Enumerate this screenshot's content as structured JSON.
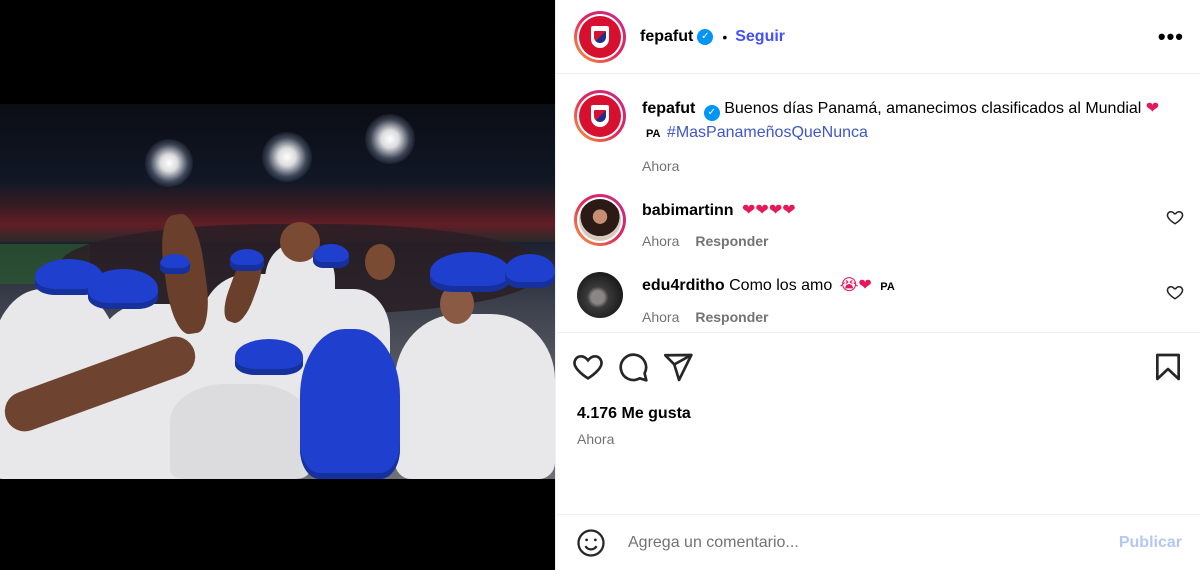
{
  "post": {
    "username": "fepafut",
    "follow_label": "Seguir",
    "more_label": "•••",
    "caption_text": "Buenos días Panamá, amanecimos clasificados al Mundial",
    "caption_heart": "❤",
    "caption_flag": "PA",
    "caption_hashtag": "#MasPanameñosQueNunca",
    "caption_time": "Ahora",
    "likes": "4.176 Me gusta",
    "time": "Ahora"
  },
  "comments": [
    {
      "username": "babimartinn",
      "text": "",
      "emojis": "❤❤❤❤",
      "flag": "",
      "time": "Ahora",
      "reply_label": "Responder"
    },
    {
      "username": "edu4rditho",
      "text": "Como los amo",
      "emojis": "😭❤",
      "flag": "PA",
      "time": "Ahora",
      "reply_label": "Responder"
    }
  ],
  "composer": {
    "placeholder": "Agrega un comentario...",
    "publish_label": "Publicar"
  },
  "icons": {
    "verified": "verified-badge-icon",
    "like": "heart-icon",
    "comment": "comment-bubble-icon",
    "share": "paper-plane-icon",
    "save": "bookmark-icon",
    "emoji": "smiley-face-icon"
  },
  "colors": {
    "accent_blue": "#4150f7",
    "hashtag_blue": "#3e56c8",
    "heart_red": "#e6185a",
    "muted_text": "#737373",
    "publish_disabled": "#b3c7f5",
    "verified_blue": "#0095f6"
  }
}
